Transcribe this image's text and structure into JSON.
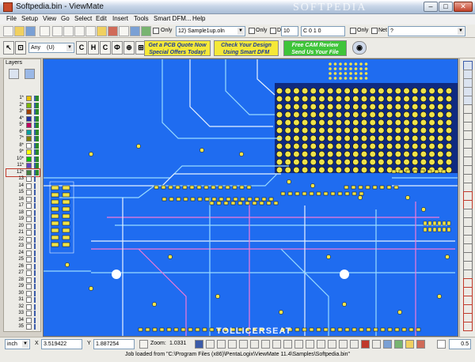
{
  "window": {
    "title": "Softpedia.bin - ViewMate",
    "watermark": "SOFTPEDIA",
    "minimize": "–",
    "maximize": "□",
    "close": "✕"
  },
  "menu": [
    "File",
    "Setup",
    "View",
    "Go",
    "Select",
    "Edit",
    "Insert",
    "Tools",
    "Smart DFM...",
    "Help"
  ],
  "toolbar1": {
    "only_label_1": "Only",
    "layer_select": "12) Sample1up.oln",
    "only_label_2": "Only",
    "d_code_label": "D",
    "d_code_value": "10",
    "c_field_value": "C 0 1 0",
    "only_label_3": "Only",
    "net_label": "Net",
    "net_value": "?"
  },
  "toolbar2": {
    "snap_select": "Any",
    "snap_mode": "(U)",
    "letter_buttons": [
      "C",
      "H",
      "C",
      "Ф",
      "⊕",
      "⊞"
    ],
    "promo_1_line1": "Get a PCB Quote Now",
    "promo_1_line2": "Special Offers Today!",
    "promo_2_line1": "Check Your Design",
    "promo_2_line2": "Using Smart DFM",
    "promo_3_line1": "Free CAM Review",
    "promo_3_line2": "Send Us Your File"
  },
  "layers": {
    "title": "Layers",
    "items": [
      {
        "label": "1*",
        "color": "#e8c000"
      },
      {
        "label": "2*",
        "color": "#7ab800"
      },
      {
        "label": "3*",
        "color": "#a04000"
      },
      {
        "label": "4*",
        "color": "#2030a0"
      },
      {
        "label": "5*",
        "color": "#c00060"
      },
      {
        "label": "6*",
        "color": "#00a0a0"
      },
      {
        "label": "7*",
        "color": "#808000"
      },
      {
        "label": "8*",
        "color": "#ffffff"
      },
      {
        "label": "9*",
        "color": "#ffff00"
      },
      {
        "label": "10*",
        "color": "#00c000"
      },
      {
        "label": "11*",
        "color": "#6040c0"
      },
      {
        "label": "12*",
        "color": "#408040"
      },
      {
        "label": "13",
        "color": "#ffffff"
      },
      {
        "label": "14",
        "color": "#ffffff"
      },
      {
        "label": "15",
        "color": "#ffffff"
      },
      {
        "label": "16",
        "color": "#ffffff"
      },
      {
        "label": "17",
        "color": "#ffffff"
      },
      {
        "label": "18",
        "color": "#ffffff"
      },
      {
        "label": "19",
        "color": "#ffffff"
      },
      {
        "label": "20",
        "color": "#ffffff"
      },
      {
        "label": "21",
        "color": "#ffffff"
      },
      {
        "label": "22",
        "color": "#ffffff"
      },
      {
        "label": "23",
        "color": "#ffffff"
      },
      {
        "label": "24",
        "color": "#ffffff"
      },
      {
        "label": "25",
        "color": "#ffffff"
      },
      {
        "label": "26",
        "color": "#ffffff"
      },
      {
        "label": "27",
        "color": "#ffffff"
      },
      {
        "label": "28",
        "color": "#ffffff"
      },
      {
        "label": "29",
        "color": "#ffffff"
      },
      {
        "label": "30",
        "color": "#ffffff"
      },
      {
        "label": "31",
        "color": "#ffffff"
      },
      {
        "label": "32",
        "color": "#ffffff"
      },
      {
        "label": "33",
        "color": "#ffffff"
      },
      {
        "label": "34",
        "color": "#ffffff"
      },
      {
        "label": "35",
        "color": "#ffffff"
      }
    ],
    "selected": "12*"
  },
  "canvas": {
    "background": "#1f6cf0",
    "logo_overlay": "TOLLICERSEAT"
  },
  "status": {
    "units": "inch",
    "x_label": "X",
    "x_value": "3.519422",
    "y_label": "Y",
    "y_value": "1.887254",
    "zoom_label": "Zoom:",
    "zoom_value": "1.0331",
    "step_value": "0.5",
    "message": "Job loaded from \"C:\\Program Files (x86)\\PentaLogix\\ViewMate 11.4\\Samples\\Softpedia.bin\""
  },
  "colors": {
    "board": "#1f6cf0",
    "pad": "#f0e34a",
    "pad_ring": "#0b0b0b",
    "trace_cyan": "#9adcff",
    "trace_white": "#e8f2ff",
    "trace_magenta": "#f27ad8",
    "plane": "#0f2a80"
  }
}
